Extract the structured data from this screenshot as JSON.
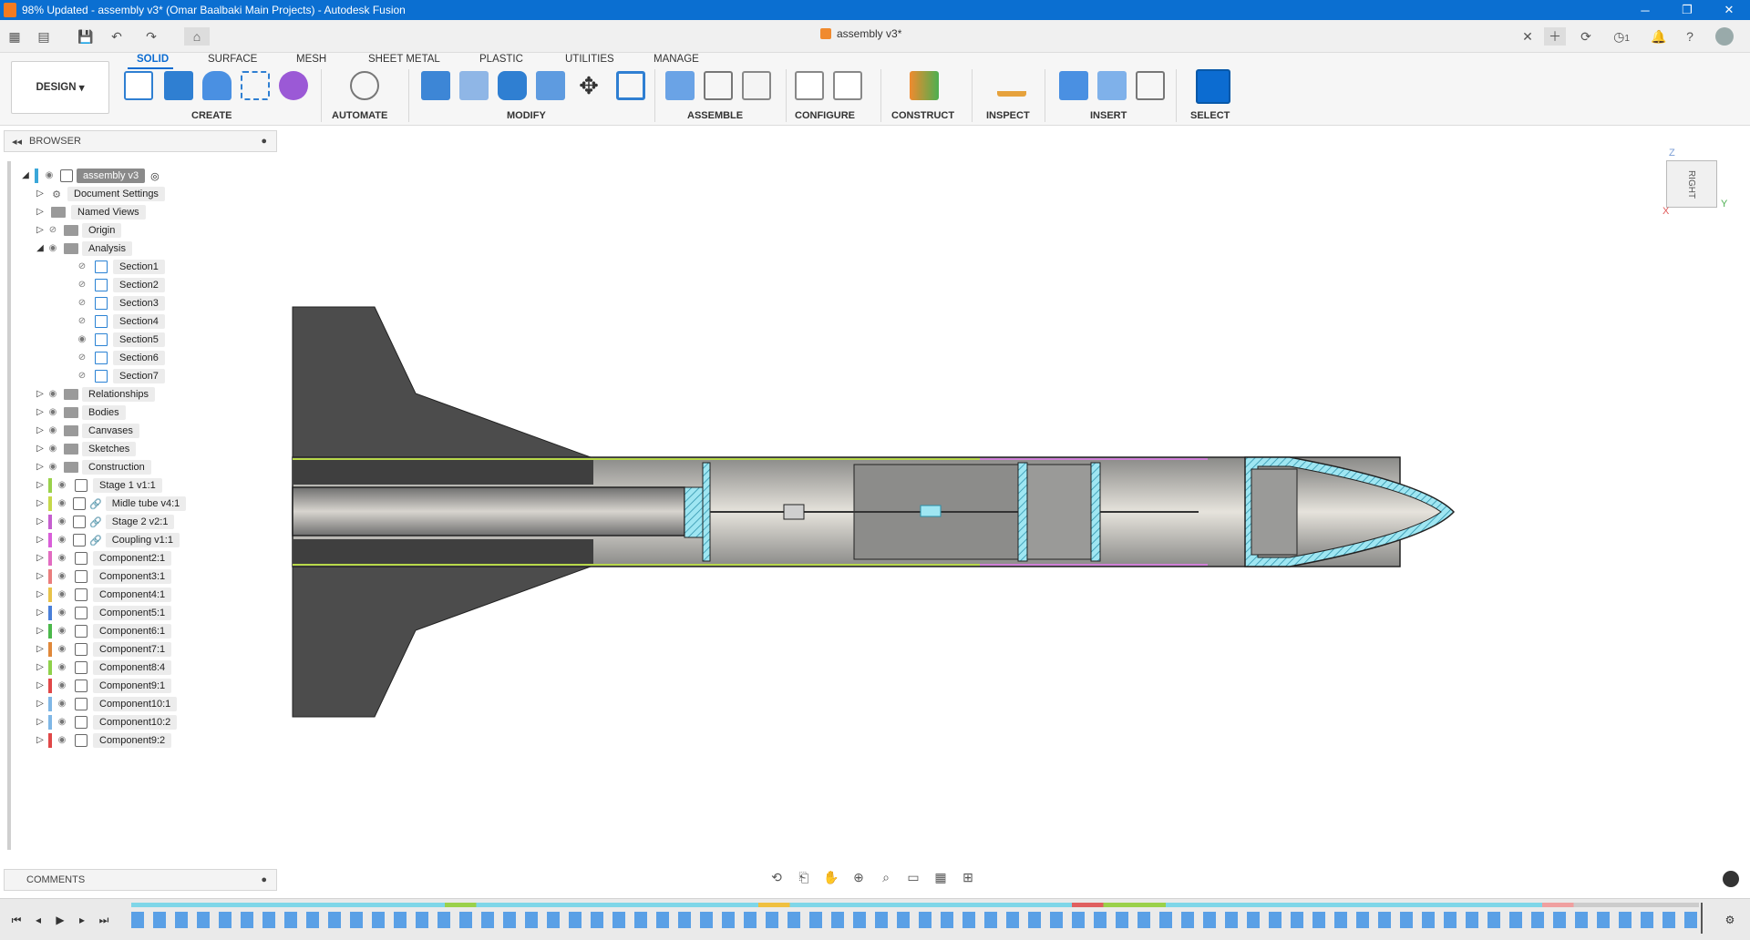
{
  "window": {
    "title": "98% Updated - assembly v3* (Omar Baalbaki Main Projects) - Autodesk Fusion"
  },
  "document_tab": {
    "label": "assembly v3*"
  },
  "quickbar": {
    "notifications": "1"
  },
  "ribbon": {
    "tabs": [
      "SOLID",
      "SURFACE",
      "MESH",
      "SHEET METAL",
      "PLASTIC",
      "UTILITIES",
      "MANAGE"
    ],
    "workspace": "DESIGN",
    "groups": [
      "CREATE",
      "AUTOMATE",
      "MODIFY",
      "ASSEMBLE",
      "CONFIGURE",
      "CONSTRUCT",
      "INSPECT",
      "INSERT",
      "SELECT"
    ]
  },
  "browser": {
    "header": "BROWSER",
    "root": "assembly v3",
    "items": [
      {
        "label": "Document Settings"
      },
      {
        "label": "Named Views"
      },
      {
        "label": "Origin"
      },
      {
        "label": "Analysis"
      },
      {
        "label": "Section1"
      },
      {
        "label": "Section2"
      },
      {
        "label": "Section3"
      },
      {
        "label": "Section4"
      },
      {
        "label": "Section5"
      },
      {
        "label": "Section6"
      },
      {
        "label": "Section7"
      },
      {
        "label": "Relationships"
      },
      {
        "label": "Bodies"
      },
      {
        "label": "Canvases"
      },
      {
        "label": "Sketches"
      },
      {
        "label": "Construction"
      },
      {
        "label": "Stage 1 v1:1"
      },
      {
        "label": "Midle tube v4:1"
      },
      {
        "label": "Stage 2 v2:1"
      },
      {
        "label": "Coupling v1:1"
      },
      {
        "label": "Component2:1"
      },
      {
        "label": "Component3:1"
      },
      {
        "label": "Component4:1"
      },
      {
        "label": "Component5:1"
      },
      {
        "label": "Component6:1"
      },
      {
        "label": "Component7:1"
      },
      {
        "label": "Component8:4"
      },
      {
        "label": "Component9:1"
      },
      {
        "label": "Component10:1"
      },
      {
        "label": "Component10:2"
      },
      {
        "label": "Component9:2"
      }
    ]
  },
  "comments": {
    "header": "COMMENTS"
  },
  "viewcube": {
    "face": "RIGHT",
    "axis_z": "Z",
    "axis_y": "Y",
    "axis_x": "X"
  },
  "colors": {
    "accent": "#0c6cd1",
    "titlebar": "#0b6fd1"
  }
}
